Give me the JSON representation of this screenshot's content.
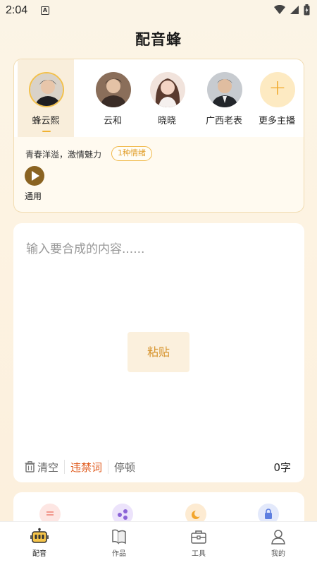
{
  "status_bar": {
    "time": "2:04",
    "notification_letter": "A"
  },
  "app": {
    "title": "配音蜂"
  },
  "voices": [
    {
      "name": "蜂云熙",
      "selected": true
    },
    {
      "name": "云和",
      "selected": false
    },
    {
      "name": "晓晓",
      "selected": false
    },
    {
      "name": "广西老表",
      "selected": false
    }
  ],
  "more_voices": {
    "icon": "plus-icon",
    "label": "更多主播"
  },
  "voice_detail": {
    "description": "青春洋溢，激情魅力",
    "emotion_badge": "1种情绪",
    "style_label": "通用"
  },
  "editor": {
    "placeholder": "输入要合成的内容......",
    "paste_label": "粘贴",
    "clear_label": "清空",
    "banned_words_label": "违禁词",
    "pause_label": "停顿",
    "char_count": "0字"
  },
  "colors": {
    "accent": "#f0b232",
    "warn": "#e05a1c",
    "paste_text": "#d6932c"
  },
  "bottom_nav": {
    "items": [
      {
        "label": "配音",
        "icon": "robot-icon",
        "active": true
      },
      {
        "label": "作品",
        "icon": "works-icon",
        "active": false
      },
      {
        "label": "工具",
        "icon": "toolbox-icon",
        "active": false
      },
      {
        "label": "我的",
        "icon": "user-icon",
        "active": false
      }
    ]
  }
}
